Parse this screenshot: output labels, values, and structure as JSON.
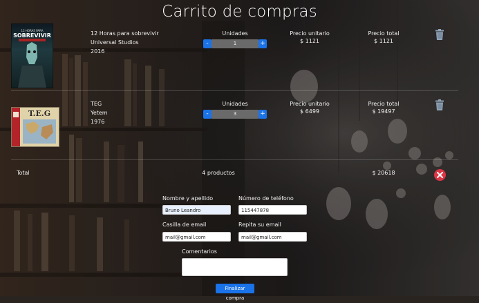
{
  "page": {
    "title": "Carrito de compras"
  },
  "items": [
    {
      "name": "12 Horas para sobrevivir",
      "publisher": "Universal Studios",
      "year": "2016",
      "units_label": "Unidades",
      "quantity": "1",
      "unit_price_label": "Precio unitario",
      "unit_price": "$ 1121",
      "total_label": "Precio total",
      "total": "$ 1121",
      "cover_text": "SOBREVIVIR"
    },
    {
      "name": "TEG",
      "publisher": "Yetem",
      "year": "1976",
      "units_label": "Unidades",
      "quantity": "3",
      "unit_price_label": "Precio unitario",
      "unit_price": "$ 6499",
      "total_label": "Precio total",
      "total": "$ 19497",
      "cover_text": "T.E.G"
    }
  ],
  "stepper": {
    "minus": "-",
    "plus": "+"
  },
  "summary": {
    "label": "Total",
    "count": "4 productos",
    "total": "$ 20618"
  },
  "form": {
    "name_label": "Nombre y apellido",
    "name_value": "Bruno Leandro",
    "phone_label": "Número de teléfono",
    "phone_value": "115447878",
    "email_label": "Casilla de email",
    "email_value": "mail@gmail.com",
    "email_repeat_label": "Repita su email",
    "email_repeat_value": "mail@gmail.com",
    "comments_label": "Comentarios",
    "submit_label": "Finalizar compra"
  },
  "colors": {
    "accent": "#1a73e8",
    "danger": "#dc3545",
    "trash": "#8fa3b8"
  },
  "icons": {
    "trash": "trash-icon",
    "clear": "close-circle-icon"
  }
}
